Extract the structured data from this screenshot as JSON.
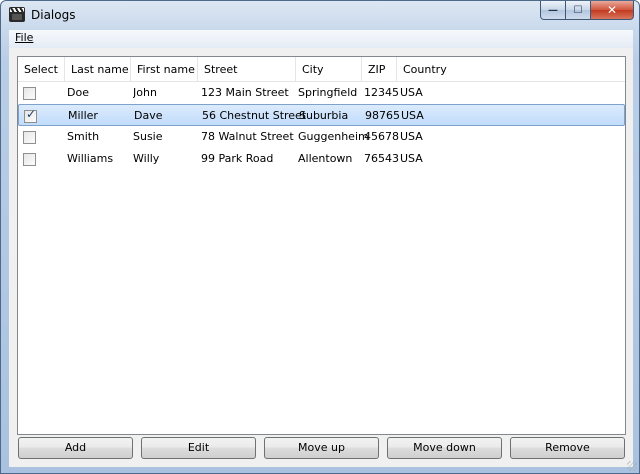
{
  "window": {
    "title": "Dialogs",
    "minimize_glyph": "—",
    "maximize_glyph": "☐",
    "close_glyph": "✕"
  },
  "menu": {
    "file_label": "File"
  },
  "table": {
    "columns": [
      "Select",
      "Last name",
      "First name",
      "Street",
      "City",
      "ZIP",
      "Country"
    ],
    "rows": [
      {
        "checked": false,
        "last_name": "Doe",
        "first_name": "John",
        "street": "123 Main Street",
        "city": "Springfield",
        "zip": "12345",
        "country": "USA"
      },
      {
        "checked": true,
        "last_name": "Miller",
        "first_name": "Dave",
        "street": "56 Chestnut Street",
        "city": "Suburbia",
        "zip": "98765",
        "country": "USA"
      },
      {
        "checked": false,
        "last_name": "Smith",
        "first_name": "Susie",
        "street": "78 Walnut Street",
        "city": "Guggenheim",
        "zip": "45678",
        "country": "USA"
      },
      {
        "checked": false,
        "last_name": "Williams",
        "first_name": "Willy",
        "street": "99 Park Road",
        "city": "Allentown",
        "zip": "76543",
        "country": "USA"
      }
    ],
    "selected_row": 1
  },
  "buttons": {
    "add": "Add",
    "edit": "Edit",
    "move_up": "Move up",
    "move_down": "Move down",
    "remove": "Remove"
  },
  "colors": {
    "selection_border": "#7da2ce",
    "selection_fill": "#c1dcfc",
    "close_button": "#c23a1f"
  },
  "icons": {
    "app": "clapperboard-icon",
    "checkbox": "checkbox-icon"
  }
}
